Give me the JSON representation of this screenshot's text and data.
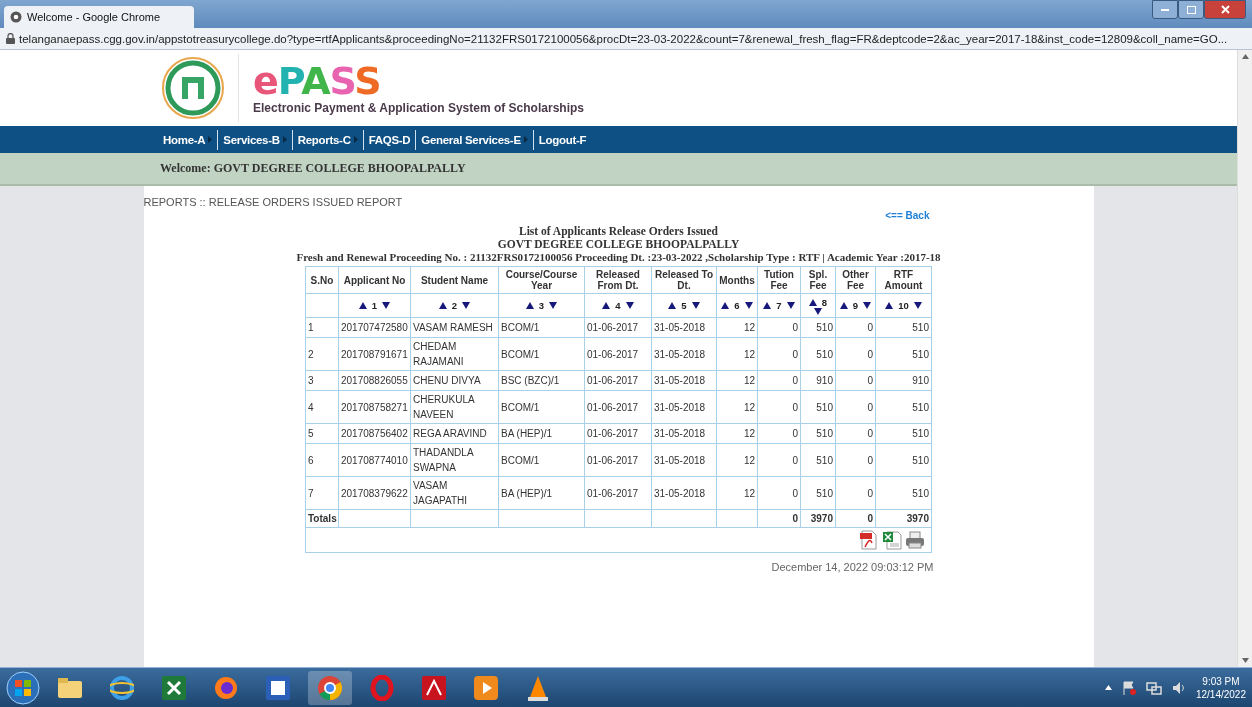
{
  "window": {
    "title": "Welcome - Google Chrome"
  },
  "address_bar": {
    "url": "telanganaepass.cgg.gov.in/appstotreasurycollege.do?type=rtfApplicants&proceedingNo=21132FRS0172100056&procDt=23-03-2022&count=7&renewal_fresh_flag=FR&deptcode=2&ac_year=2017-18&inst_code=12809&coll_name=GO..."
  },
  "header": {
    "logo_text": "ePASS",
    "subtitle": "Electronic Payment & Application System of Scholarships"
  },
  "nav": [
    {
      "label": "Home-A",
      "submenu": true
    },
    {
      "label": "Services-B",
      "submenu": true
    },
    {
      "label": "Reports-C",
      "submenu": true
    },
    {
      "label": "FAQS-D",
      "submenu": false
    },
    {
      "label": "General Services-E",
      "submenu": true
    },
    {
      "label": "Logout-F",
      "submenu": false
    }
  ],
  "welcome": "Welcome: GOVT DEGREE COLLEGE BHOOPALPALLY",
  "report": {
    "breadcrumb": "REPORTS :: RELEASE ORDERS ISSUED REPORT",
    "back_link": "<== Back",
    "titles": [
      "List of Applicants Release Orders Issued",
      "GOVT DEGREE COLLEGE BHOOPALPALLY",
      "Fresh and Renewal Proceeding No. : 21132FRS0172100056 Proceeding Dt. :23-03-2022 ,Scholarship Type : RTF | Academic Year :2017-18"
    ],
    "table": {
      "columns": [
        {
          "label": "S.No"
        },
        {
          "label": "Applicant No",
          "sort": "1"
        },
        {
          "label": "Student Name",
          "sort": "2"
        },
        {
          "label": "Course/Course Year",
          "sort": "3"
        },
        {
          "label": "Released From Dt.",
          "sort": "4"
        },
        {
          "label": "Released To Dt.",
          "sort": "5"
        },
        {
          "label": "Months",
          "sort": "6"
        },
        {
          "label": "Tution Fee",
          "sort": "7"
        },
        {
          "label": "Spl. Fee",
          "sort": "8"
        },
        {
          "label": "Other Fee",
          "sort": "9"
        },
        {
          "label": "RTF Amount",
          "sort": "10"
        }
      ],
      "rows": [
        [
          "1",
          "201707472580",
          "VASAM RAMESH",
          "BCOM/1",
          "01-06-2017",
          "31-05-2018",
          "12",
          "0",
          "510",
          "0",
          "510"
        ],
        [
          "2",
          "201708791671",
          "CHEDAM RAJAMANI",
          "BCOM/1",
          "01-06-2017",
          "31-05-2018",
          "12",
          "0",
          "510",
          "0",
          "510"
        ],
        [
          "3",
          "201708826055",
          "CHENU DIVYA",
          "BSC (BZC)/1",
          "01-06-2017",
          "31-05-2018",
          "12",
          "0",
          "910",
          "0",
          "910"
        ],
        [
          "4",
          "201708758271",
          "CHERUKULA NAVEEN",
          "BCOM/1",
          "01-06-2017",
          "31-05-2018",
          "12",
          "0",
          "510",
          "0",
          "510"
        ],
        [
          "5",
          "201708756402",
          "REGA ARAVIND",
          "BA (HEP)/1",
          "01-06-2017",
          "31-05-2018",
          "12",
          "0",
          "510",
          "0",
          "510"
        ],
        [
          "6",
          "201708774010",
          "THADANDLA SWAPNA",
          "BCOM/1",
          "01-06-2017",
          "31-05-2018",
          "12",
          "0",
          "510",
          "0",
          "510"
        ],
        [
          "7",
          "201708379622",
          "VASAM JAGAPATHI",
          "BA (HEP)/1",
          "01-06-2017",
          "31-05-2018",
          "12",
          "0",
          "510",
          "0",
          "510"
        ]
      ],
      "totals": {
        "label": "Totals",
        "tution_fee": "0",
        "spl_fee": "3970",
        "other_fee": "0",
        "rtf_amount": "3970"
      }
    },
    "timestamp": "December 14, 2022 09:03:12 PM"
  },
  "taskbar": {
    "time": "9:03 PM",
    "date": "12/14/2022"
  }
}
